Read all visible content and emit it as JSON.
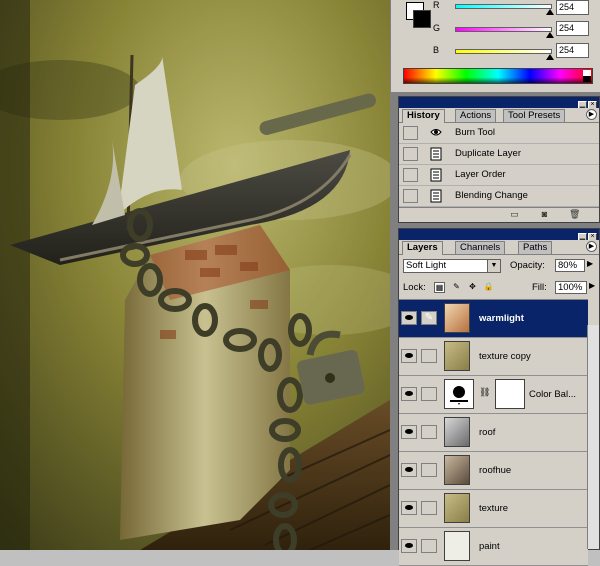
{
  "color_panel": {
    "channels": [
      {
        "label": "R",
        "value": "254",
        "gradient_from": "#00ffff",
        "gradient_to": "#ffffff"
      },
      {
        "label": "G",
        "value": "254",
        "gradient_from": "#ff00ff",
        "gradient_to": "#ffffff"
      },
      {
        "label": "B",
        "value": "254",
        "gradient_from": "#ffff00",
        "gradient_to": "#ffffff"
      }
    ],
    "foreground": "#ffffff",
    "background": "#000000"
  },
  "history_panel": {
    "tabs": [
      "History",
      "Actions",
      "Tool Presets"
    ],
    "active_tab": "History",
    "items": [
      {
        "label": "Burn Tool",
        "icon": "burn-tool-icon"
      },
      {
        "label": "Duplicate Layer",
        "icon": "history-state-icon"
      },
      {
        "label": "Layer Order",
        "icon": "history-state-icon"
      },
      {
        "label": "Blending Change",
        "icon": "history-state-icon"
      }
    ]
  },
  "layers_panel": {
    "tabs": [
      "Layers",
      "Channels",
      "Paths"
    ],
    "active_tab": "Layers",
    "blend_mode": "Soft Light",
    "opacity_label": "Opacity:",
    "opacity": "80%",
    "lock_label": "Lock:",
    "fill_label": "Fill:",
    "fill": "100%",
    "layers": [
      {
        "name": "warmlight",
        "selected": true,
        "thumb": "#c08a5a"
      },
      {
        "name": "texture copy",
        "selected": false,
        "thumb": "#a89a60"
      },
      {
        "name": "Color Bal...",
        "selected": false,
        "thumb": "adjustment"
      },
      {
        "name": "roof",
        "selected": false,
        "thumb": "#9a9a9a"
      },
      {
        "name": "roofhue",
        "selected": false,
        "thumb": "#8a7a6a"
      },
      {
        "name": "texture",
        "selected": false,
        "thumb": "#a89a60"
      },
      {
        "name": "paint",
        "selected": false,
        "thumb": "#e8e8e0"
      }
    ]
  },
  "colors": {
    "title_bar": "#0a246a",
    "panel_bg": "#d4d0c8",
    "selection": "#0a246a"
  }
}
